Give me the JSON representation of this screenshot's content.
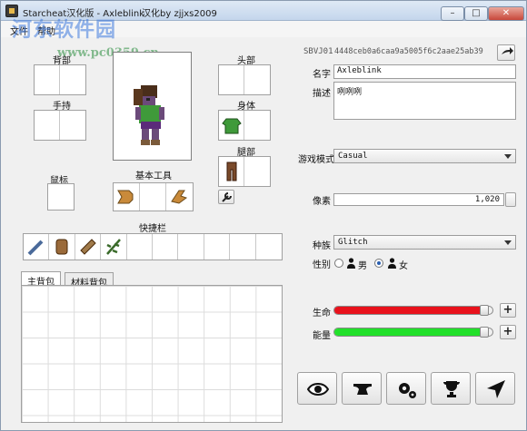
{
  "window": {
    "title": "Starcheat汉化版 - Axleblink",
    "subtitle": "汉化by zjjxs2009",
    "min": "–",
    "max": "□",
    "close": "✕"
  },
  "watermark": {
    "logo": "河东软件园",
    "url": "www.pc0359.cn"
  },
  "menu": [
    "文件",
    "帮助"
  ],
  "equipment": {
    "back": "背部",
    "head": "头部",
    "hands": "手持",
    "body": "身体",
    "legs": "腿部",
    "cursor": "鼠标",
    "basic_tools": "基本工具",
    "hotbar": "快捷栏"
  },
  "inventory_tabs": [
    "主背包",
    "材料背包"
  ],
  "player": {
    "uuid_label": "SBVJ01",
    "uuid": "4448ceb0a6caa9a5005f6c2aae25ab39",
    "name_label": "名字",
    "name": "Axleblink",
    "desc_label": "描述",
    "desc": "咧咧咧",
    "mode_label": "游戏模式",
    "mode": "Casual",
    "pixels_label": "像素",
    "pixels": "1,020",
    "species_label": "种族",
    "species": "Glitch",
    "gender_label": "性别",
    "gender_male": "男",
    "gender_female": "女",
    "gender_selected": "female",
    "health_label": "生命",
    "health": 0.96,
    "energy_label": "能量",
    "energy": 0.96
  },
  "colors": {
    "health": "#e8121c",
    "energy": "#22e02a"
  },
  "icons": [
    "export-icon",
    "wrench-icon",
    "eye-icon",
    "anvil-icon",
    "gears-icon",
    "trophy-icon",
    "navigate-icon"
  ]
}
